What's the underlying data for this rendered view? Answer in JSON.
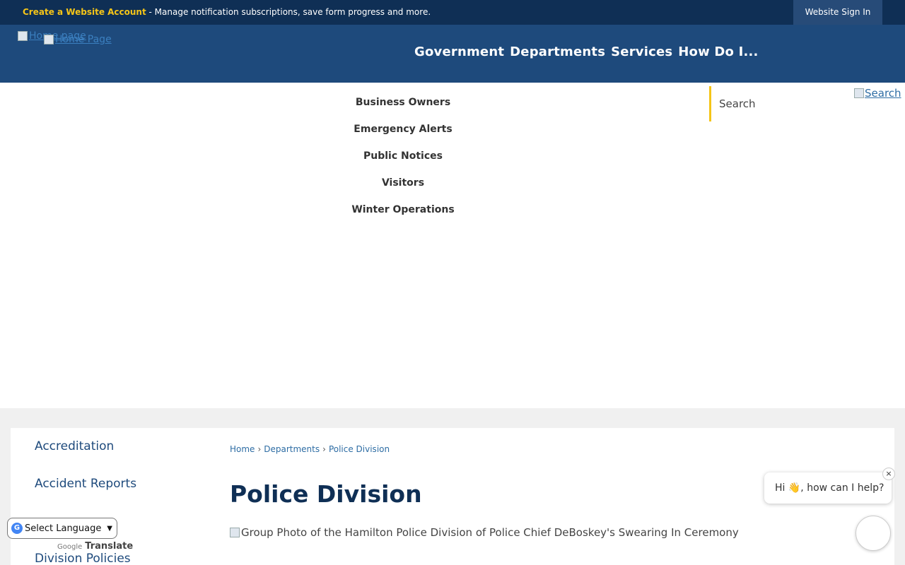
{
  "topbar": {
    "create_account": "Create a Website Account",
    "message": " - Manage notification subscriptions, save form progress and more.",
    "sign_in": "Website Sign In"
  },
  "header": {
    "logo_alt_1": "Home page",
    "logo_alt_2": "Home Page",
    "nav": [
      "Government",
      "Departments",
      "Services",
      "How Do I..."
    ]
  },
  "quick_links": [
    "Business Owners",
    "Emergency Alerts",
    "Public Notices",
    "Visitors",
    "Winter Operations"
  ],
  "search": {
    "placeholder": "Search",
    "button_alt": "Search"
  },
  "sidebar": {
    "items": [
      "Accreditation",
      "Accident Reports",
      "Division Policies"
    ]
  },
  "breadcrumb": [
    "Home",
    "Departments",
    "Police Division"
  ],
  "page_title": "Police Division",
  "photo_alt": "Group Photo of the Hamilton Police Division of Police Chief DeBoskey's Swearing In Ceremony",
  "translate": {
    "select_label": "Select Language",
    "powered_by": "Google",
    "translate_label": "Translate"
  },
  "chat": {
    "greeting": "Hi 👋, how can I help?",
    "close": "×"
  },
  "colors": {
    "topbar": "#0f2f55",
    "header": "#1e4a7c",
    "accent": "#f5c518"
  }
}
